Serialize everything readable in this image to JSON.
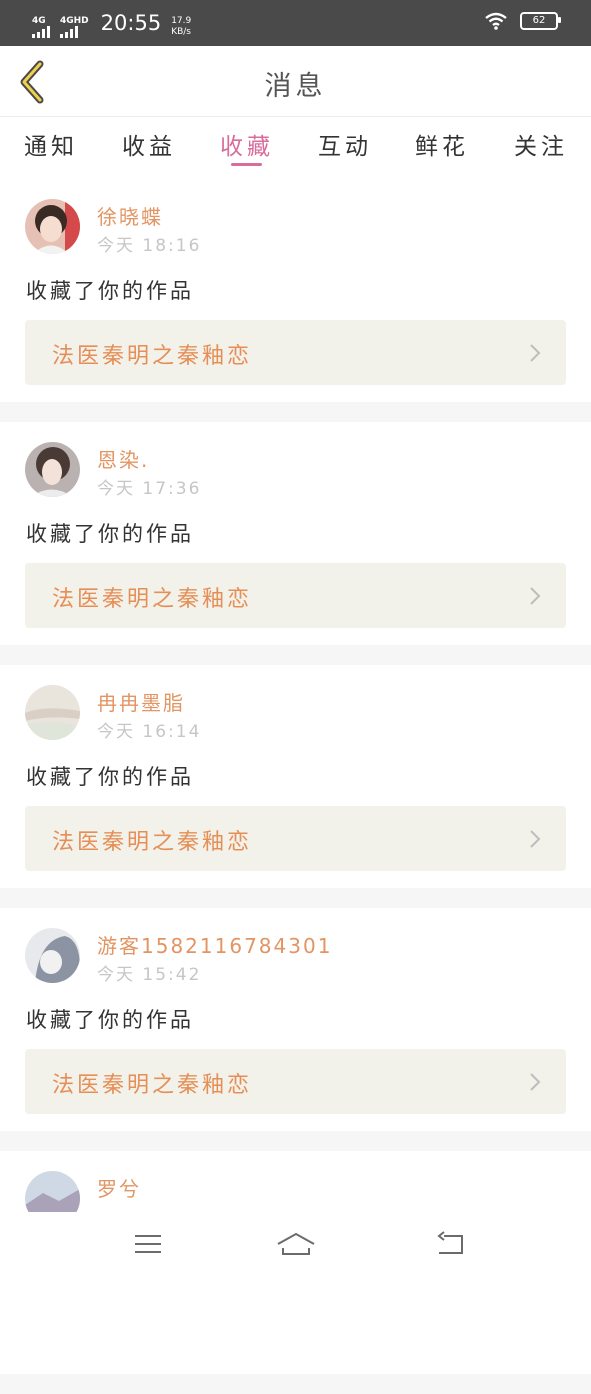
{
  "status_bar": {
    "sim1": "4G",
    "sim2": "4GHD",
    "time": "20:55",
    "speed_value": "17.9",
    "speed_unit": "KB/s",
    "battery": "62"
  },
  "header": {
    "title": "消息"
  },
  "tabs": [
    {
      "label": "通知",
      "active": false
    },
    {
      "label": "收益",
      "active": false
    },
    {
      "label": "收藏",
      "active": true
    },
    {
      "label": "互动",
      "active": false
    },
    {
      "label": "鲜花",
      "active": false
    },
    {
      "label": "关注",
      "active": false
    }
  ],
  "colors": {
    "accent_pink": "#d86d9c",
    "name_orange": "#e29563",
    "work_orange": "#e58f56",
    "work_bg": "#f2f1ea"
  },
  "feed": [
    {
      "user": "徐晓蝶",
      "time": "今天 18:16",
      "action": "收藏了你的作品",
      "work": "法医秦明之秦釉恋"
    },
    {
      "user": "恩染.",
      "time": "今天 17:36",
      "action": "收藏了你的作品",
      "work": "法医秦明之秦釉恋"
    },
    {
      "user": "冉冉墨脂",
      "time": "今天 16:14",
      "action": "收藏了你的作品",
      "work": "法医秦明之秦釉恋"
    },
    {
      "user": "游客1582116784301",
      "time": "今天 15:42",
      "action": "收藏了你的作品",
      "work": "法医秦明之秦釉恋"
    },
    {
      "user": "罗兮",
      "time": "",
      "action": "",
      "work": ""
    }
  ]
}
